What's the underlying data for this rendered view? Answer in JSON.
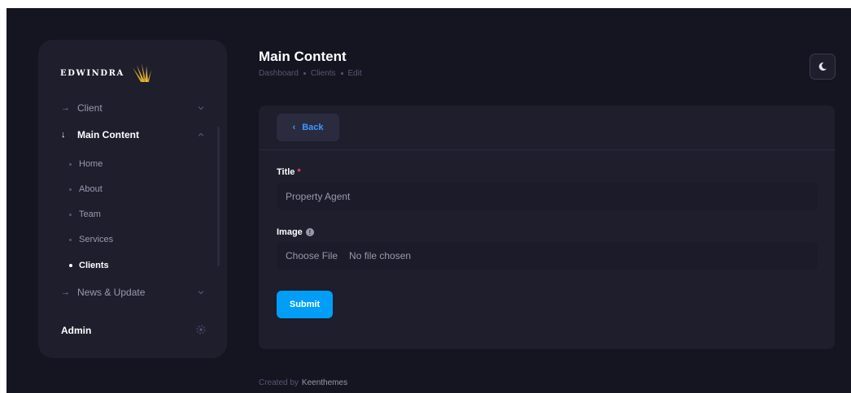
{
  "sidebar": {
    "logo_text": "EDWINDRA",
    "menu": [
      {
        "label": "Client",
        "icon": "arrow-right-icon",
        "open": false
      },
      {
        "label": "Main Content",
        "icon": "arrow-down-icon",
        "open": true
      },
      {
        "label": "News & Update",
        "icon": "arrow-right-icon",
        "open": false
      }
    ],
    "submenu": [
      {
        "label": "Home",
        "active": false
      },
      {
        "label": "About",
        "active": false
      },
      {
        "label": "Team",
        "active": false
      },
      {
        "label": "Services",
        "active": false
      },
      {
        "label": "Clients",
        "active": true
      }
    ],
    "footer_user": "Admin"
  },
  "header": {
    "title": "Main Content",
    "breadcrumb": [
      "Dashboard",
      "Clients",
      "Edit"
    ]
  },
  "form": {
    "back_label": "Back",
    "title_label": "Title",
    "required_mark": "*",
    "title_value": "Property Agent",
    "image_label": "Image",
    "info_mark": "!",
    "file_button_label": "Choose File",
    "file_status": "No file chosen",
    "submit_label": "Submit"
  },
  "footer": {
    "created_by": "Created by",
    "brand": "Keenthemes"
  },
  "colors": {
    "background": "#151521",
    "panel": "#1e1e2d",
    "primary": "#009ef7",
    "back_text": "#3e97ff",
    "required": "#f1416c",
    "logo_gold": "#d4a62a"
  }
}
